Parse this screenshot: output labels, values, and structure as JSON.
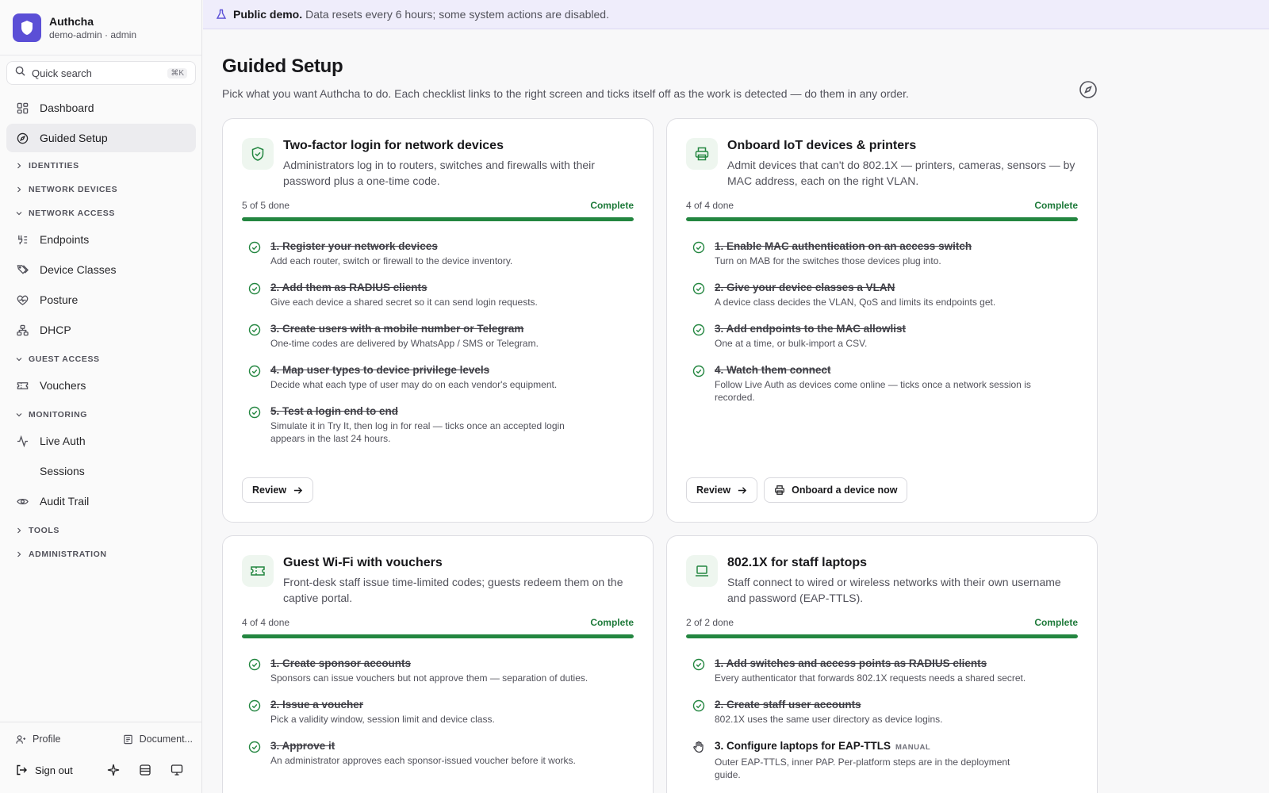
{
  "brand": {
    "name": "Authcha",
    "subtitle": "demo-admin · admin"
  },
  "search": {
    "placeholder": "Quick search",
    "shortcut": "⌘K"
  },
  "nav": {
    "dashboard": "Dashboard",
    "guided_setup": "Guided Setup",
    "identities": "IDENTITIES",
    "network_devices": "NETWORK DEVICES",
    "network_access": "NETWORK ACCESS",
    "endpoints": "Endpoints",
    "device_classes": "Device Classes",
    "posture": "Posture",
    "dhcp": "DHCP",
    "guest_access": "GUEST ACCESS",
    "vouchers": "Vouchers",
    "monitoring": "MONITORING",
    "live_auth": "Live Auth",
    "sessions": "Sessions",
    "audit_trail": "Audit Trail",
    "tools": "TOOLS",
    "administration": "ADMINISTRATION"
  },
  "footer": {
    "profile": "Profile",
    "documentation": "Document...",
    "sign_out": "Sign out"
  },
  "banner": {
    "strong": "Public demo.",
    "text": "Data resets every 6 hours; some system actions are disabled."
  },
  "page": {
    "title": "Guided Setup",
    "description": "Pick what you want Authcha to do. Each checklist links to the right screen and ticks itself off as the work is detected — do them in any order."
  },
  "cards": [
    {
      "title": "Two-factor login for network devices",
      "description": "Administrators log in to routers, switches and firewalls with their password plus a one-time code.",
      "progress_label": "5 of 5 done",
      "status": "Complete",
      "progress": 1.0,
      "steps": [
        {
          "title": "1. Register your network devices",
          "desc": "Add each router, switch or firewall to the device inventory."
        },
        {
          "title": "2. Add them as RADIUS clients",
          "desc": "Give each device a shared secret so it can send login requests."
        },
        {
          "title": "3. Create users with a mobile number or Telegram",
          "desc": "One-time codes are delivered by WhatsApp / SMS or Telegram."
        },
        {
          "title": "4. Map user types to device privilege levels",
          "desc": "Decide what each type of user may do on each vendor's equipment."
        },
        {
          "title": "5. Test a login end to end",
          "desc": "Simulate it in Try It, then log in for real — ticks once an accepted login appears in the last 24 hours."
        }
      ],
      "review_label": "Review"
    },
    {
      "title": "Onboard IoT devices & printers",
      "description": "Admit devices that can't do 802.1X — printers, cameras, sensors — by MAC address, each on the right VLAN.",
      "progress_label": "4 of 4 done",
      "status": "Complete",
      "progress": 1.0,
      "steps": [
        {
          "title": "1. Enable MAC authentication on an access switch",
          "desc": "Turn on MAB for the switches those devices plug into."
        },
        {
          "title": "2. Give your device classes a VLAN",
          "desc": "A device class decides the VLAN, QoS and limits its endpoints get."
        },
        {
          "title": "3. Add endpoints to the MAC allowlist",
          "desc": "One at a time, or bulk-import a CSV."
        },
        {
          "title": "4. Watch them connect",
          "desc": "Follow Live Auth as devices come online — ticks once a network session is recorded."
        }
      ],
      "review_label": "Review",
      "extra_label": "Onboard a device now"
    },
    {
      "title": "Guest Wi-Fi with vouchers",
      "description": "Front-desk staff issue time-limited codes; guests redeem them on the captive portal.",
      "progress_label": "4 of 4 done",
      "status": "Complete",
      "progress": 1.0,
      "steps": [
        {
          "title": "1. Create sponsor accounts",
          "desc": "Sponsors can issue vouchers but not approve them — separation of duties."
        },
        {
          "title": "2. Issue a voucher",
          "desc": "Pick a validity window, session limit and device class."
        },
        {
          "title": "3. Approve it",
          "desc": "An administrator approves each sponsor-issued voucher before it works."
        }
      ]
    },
    {
      "title": "802.1X for staff laptops",
      "description": "Staff connect to wired or wireless networks with their own username and password (EAP-TTLS).",
      "progress_label": "2 of 2 done",
      "status": "Complete",
      "progress": 1.0,
      "steps": [
        {
          "title": "1. Add switches and access points as RADIUS clients",
          "desc": "Every authenticator that forwards 802.1X requests needs a shared secret."
        },
        {
          "title": "2. Create staff user accounts",
          "desc": "802.1X uses the same user directory as device logins."
        },
        {
          "title": "3. Configure laptops for EAP-TTLS",
          "badge": "MANUAL",
          "desc": "Outer EAP-TTLS, inner PAP. Per-platform steps are in the deployment guide."
        }
      ]
    }
  ],
  "colors": {
    "accent": "#5b4fd6",
    "success": "#238640",
    "banner_bg": "#efedfb"
  }
}
